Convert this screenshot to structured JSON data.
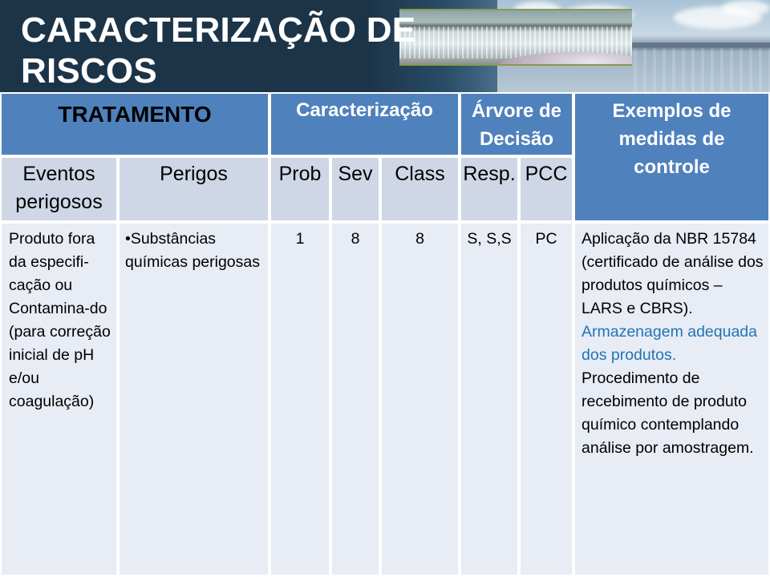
{
  "slide": {
    "title": "CARACTERIZAÇÃO DE RISCOS",
    "banner_image": "waterfall-dam-and-lake-photo"
  },
  "table": {
    "group_headers": {
      "tratamento": "TRATAMENTO",
      "caracterizacao": "Caracterização",
      "arvore_de_decisao": "Árvore de Decisão",
      "exemplos_medidas": "Exemplos de medidas de controle"
    },
    "column_headers": {
      "eventos_perigosos": "Eventos perigosos",
      "perigos": "Perigos",
      "prob": "Prob",
      "sev": "Sev",
      "class": "Class",
      "resp": "Resp.",
      "pcc": "PCC"
    },
    "rows": [
      {
        "eventos_perigosos": "Produto fora da especifi-cação ou Contamina-do (para correção inicial de pH e/ou coagulação)",
        "perigos": "•Substâncias químicas perigosas",
        "prob": "1",
        "sev": "8",
        "class": "8",
        "resp": "S, S,S",
        "pcc": "PC",
        "medidas": {
          "part1": "Aplicação da NBR 15784 (certificado de análise dos produtos químicos – LARS e CBRS).",
          "part2_highlight": "Armazenagem adequada dos produtos.",
          "part3": "Procedimento de recebimento de produto químico contemplando análise por amostragem."
        }
      }
    ]
  },
  "colors": {
    "banner_dark": "#1c3448",
    "header_blue": "#4f81bd",
    "subheader_light": "#cfd7e6",
    "body_cell": "#e8ecf4",
    "highlight_text": "#1f74b7"
  }
}
